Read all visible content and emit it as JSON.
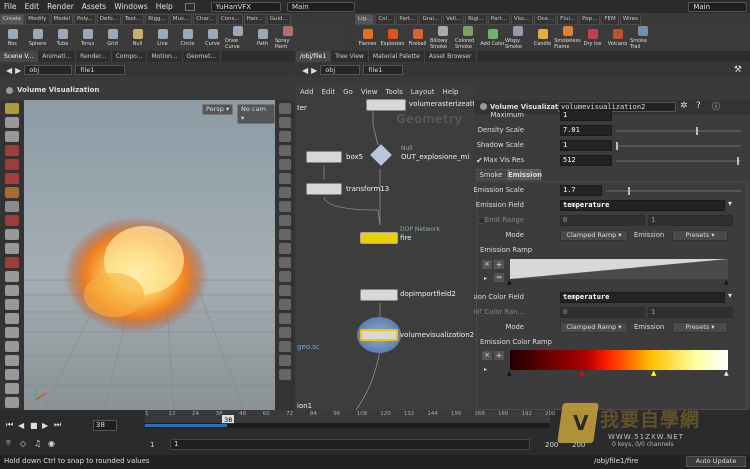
{
  "menubar": {
    "items": [
      "File",
      "Edit",
      "Render",
      "Assets",
      "Windows",
      "Help"
    ],
    "desktop": "YuHanVFX",
    "context": "Main",
    "context2": "Main"
  },
  "shelf1": {
    "tabs": [
      "Create",
      "Modify",
      "Model",
      "Poly...",
      "Defo...",
      "Text...",
      "Rigg...",
      "Mus...",
      "Char...",
      "Cons...",
      "Hair...",
      "Guid..."
    ],
    "tools": [
      {
        "label": "Box",
        "icon": "box-icon",
        "color": "#9aa8b8"
      },
      {
        "label": "Sphere",
        "icon": "sphere-icon",
        "color": "#9aa8b8"
      },
      {
        "label": "Tube",
        "icon": "tube-icon",
        "color": "#9aa8b8"
      },
      {
        "label": "Torus",
        "icon": "torus-icon",
        "color": "#9aa8b8"
      },
      {
        "label": "Grid",
        "icon": "grid-icon",
        "color": "#9aa8b8"
      },
      {
        "label": "Null",
        "icon": "null-icon",
        "color": "#c8b070"
      },
      {
        "label": "Line",
        "icon": "line-icon",
        "color": "#9aa8b8"
      },
      {
        "label": "Circle",
        "icon": "circle-icon",
        "color": "#9aa8b8"
      },
      {
        "label": "Curve",
        "icon": "curve-icon",
        "color": "#9aa8b8"
      },
      {
        "label": "Draw Curve",
        "icon": "draw-curve-icon",
        "color": "#9aa8b8"
      },
      {
        "label": "Path",
        "icon": "path-icon",
        "color": "#9aa8b8"
      },
      {
        "label": "Spray Paint",
        "icon": "spray-paint-icon",
        "color": "#b07070"
      }
    ]
  },
  "shelf2": {
    "tabs": [
      "Lig...",
      "Col...",
      "Part...",
      "Grai...",
      "Vell...",
      "Rigi...",
      "Part...",
      "Visc...",
      "Oce...",
      "Flui...",
      "Pop...",
      "FEM",
      "Wires"
    ],
    "tools": [
      {
        "label": "Flames",
        "icon": "flames-icon",
        "color": "#e07020"
      },
      {
        "label": "Explosion",
        "icon": "explosion-icon",
        "color": "#e05020"
      },
      {
        "label": "Fireball",
        "icon": "fireball-icon",
        "color": "#e06030"
      },
      {
        "label": "Billowy Smoke",
        "icon": "billowy-smoke-icon",
        "color": "#aaaaaa"
      },
      {
        "label": "Colored Smoke",
        "icon": "colored-smoke-icon",
        "color": "#80a060"
      },
      {
        "label": "Add Color",
        "icon": "add-color-icon",
        "color": "#70b070"
      },
      {
        "label": "Wispy Smoke",
        "icon": "wispy-smoke-icon",
        "color": "#9999aa"
      },
      {
        "label": "Candle",
        "icon": "candle-icon",
        "color": "#e0b040"
      },
      {
        "label": "Smokeless Flame",
        "icon": "smokeless-flame-icon",
        "color": "#e08030"
      },
      {
        "label": "Dry Ice",
        "icon": "dry-ice-icon",
        "color": "#c04050"
      },
      {
        "label": "Volcano",
        "icon": "volcano-icon",
        "color": "#c05030"
      },
      {
        "label": "Smoke Trail",
        "icon": "smoke-trail-icon",
        "color": "#7090b0"
      }
    ]
  },
  "left_tabs": [
    "Scene V...",
    "Animati...",
    "Render...",
    "Compo...",
    "Motion...",
    "Geomet..."
  ],
  "right_tabs": [
    "/obj/file1",
    "Tree View",
    "Material Palette",
    "Asset Browser"
  ],
  "path": {
    "root": "obj",
    "node": "file1"
  },
  "viewport": {
    "title": "Volume Visualization",
    "persp": "Persp",
    "cam": "No cam"
  },
  "net": {
    "menu": [
      "Add",
      "Edit",
      "Go",
      "View",
      "Tools",
      "Layout",
      "Help"
    ],
    "watermark": "Geometry",
    "nodes": {
      "volrast": "volumerasterizeatt",
      "box": "box5",
      "null_type": "Null",
      "null_name": "OUT_explosione_mi",
      "transform": "transform13",
      "dop_type": "DOP Network",
      "dop_name": "fire",
      "dopimport": "dopimportfield2",
      "volvis": "volumevisualization2"
    },
    "side_left_top": "ter",
    "side_left_geo": "geo.sc",
    "side_left_bottom": "ion1"
  },
  "params": {
    "type_label": "Volume Visualization",
    "node_name": "volumevisualization2",
    "maximum_label": "Maximum",
    "maximum_value": "1",
    "density_scale_label": "Density Scale",
    "density_scale": "7.01",
    "shadow_scale_label": "Shadow Scale",
    "shadow_scale": "1",
    "max_vis_res_label": "Max Vis Res",
    "max_vis_res": "512",
    "tabs": [
      "Smoke",
      "Emission"
    ],
    "emission_scale_label": "Emission Scale",
    "emission_scale": "1.7",
    "emission_field_label": "Emission Field",
    "emission_field": "temperature",
    "emit_range_label": "Emit Range",
    "emit_range_min": "0",
    "emit_range_max": "1",
    "mode_label": "Mode",
    "mode_value": "Clamped Ramp",
    "emission_label": "Emission",
    "presets": "Presets",
    "emission_ramp_label": "Emission Ramp",
    "emission_color_field_label": "Emission Color Field",
    "emission_color_field": "temperature",
    "emit_color_range_label": "Emit Color Ran...",
    "emit_color_range_min": "0",
    "emit_color_range_max": "1",
    "mode2_value": "Clamped Ramp",
    "emission2_label": "Emission",
    "presets2": "Presets",
    "emission_color_ramp_label": "Emission Color Ramp"
  },
  "timeline": {
    "ticks": [
      "1",
      "12",
      "24",
      "38",
      "48",
      "60",
      "72",
      "84",
      "96",
      "108",
      "120",
      "132",
      "144",
      "156",
      "168",
      "180",
      "192",
      "200"
    ],
    "frame": "38",
    "start": "1",
    "start2": "1",
    "end": "200",
    "end2": "200",
    "status": "Hold down Ctrl to snap to rounded values",
    "path": "/obj/file1/fire",
    "channels": "0 keys, 0/0 channels",
    "auto_update": "Auto Update"
  },
  "watermark": {
    "text_cn": "我要自學網",
    "url": "WWW.51ZXW.NET"
  }
}
